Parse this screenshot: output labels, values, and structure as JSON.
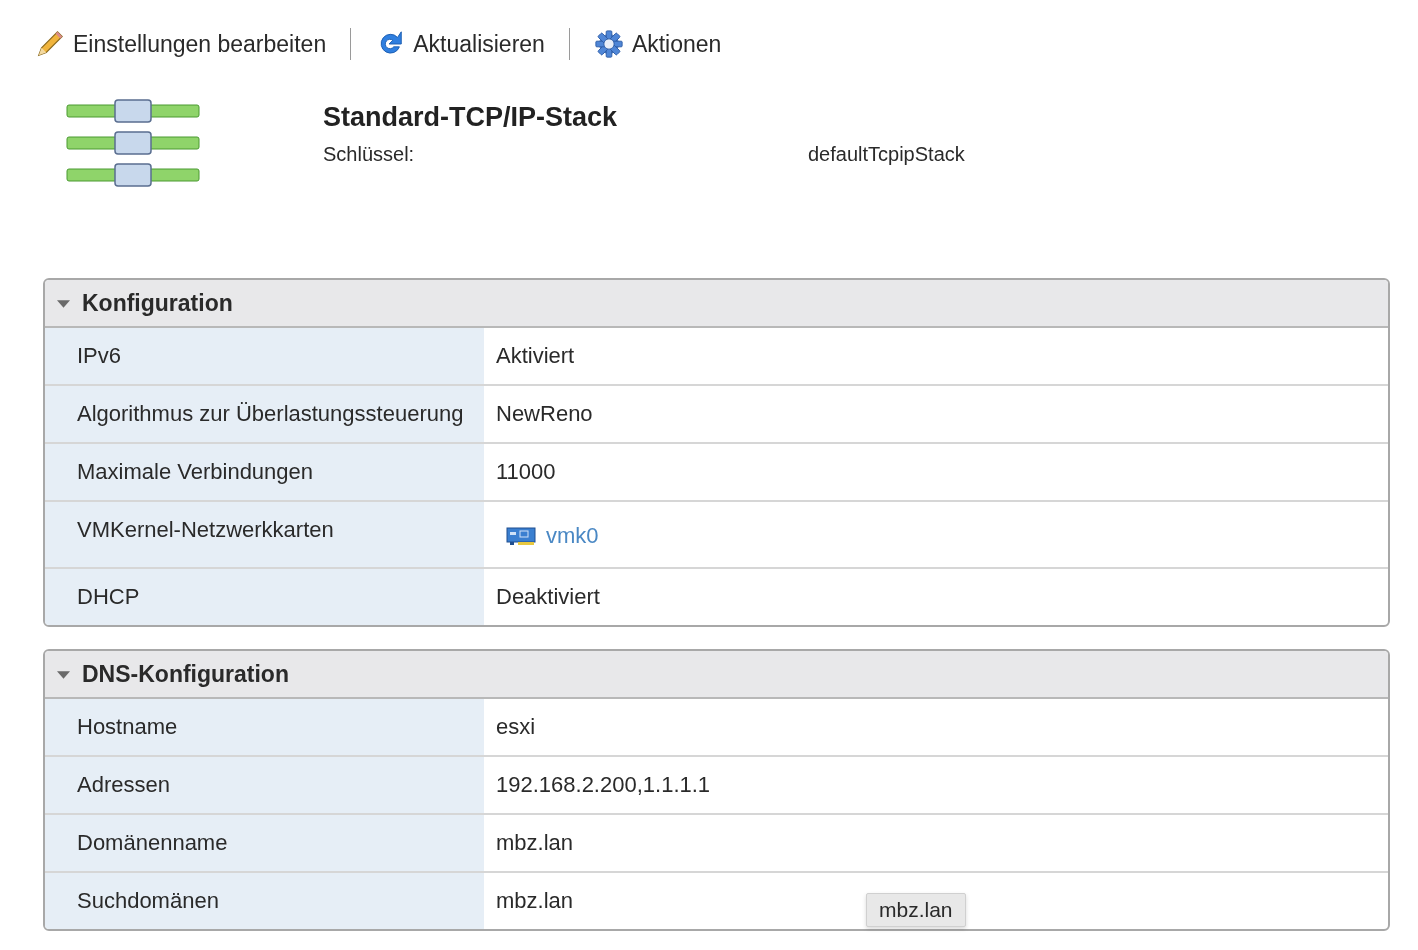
{
  "toolbar": [
    {
      "label": "Einstellungen bearbeiten"
    },
    {
      "label": "Aktualisieren"
    },
    {
      "label": "Aktionen"
    }
  ],
  "header": {
    "title": "Standard-TCP/IP-Stack",
    "key_label": "Schlüssel:",
    "key_value": "defaultTcpipStack"
  },
  "sections": [
    {
      "title": "Konfiguration",
      "expanded": true,
      "rows": [
        {
          "label": "IPv6",
          "value": "Aktiviert",
          "kind": "text"
        },
        {
          "label": "Algorithmus zur Überlastungssteuerung",
          "value": "NewReno",
          "kind": "text"
        },
        {
          "label": "Maximale Verbindungen",
          "value": "11000",
          "kind": "text"
        },
        {
          "label": "VMKernel-Netzwerkkarten",
          "value": "vmk0",
          "kind": "link"
        },
        {
          "label": "DHCP",
          "value": "Deaktiviert",
          "kind": "text"
        }
      ]
    },
    {
      "title": "DNS-Konfiguration",
      "expanded": true,
      "rows": [
        {
          "label": "Hostname",
          "value": "esxi",
          "kind": "text"
        },
        {
          "label": "Adressen",
          "value": "192.168.2.200,1.1.1.1",
          "kind": "text"
        },
        {
          "label": "Domänenname",
          "value": "mbz.lan",
          "kind": "text"
        },
        {
          "label": "Suchdomänen",
          "value": "mbz.lan",
          "kind": "text"
        }
      ]
    }
  ],
  "tooltip": {
    "text": "mbz.lan"
  }
}
